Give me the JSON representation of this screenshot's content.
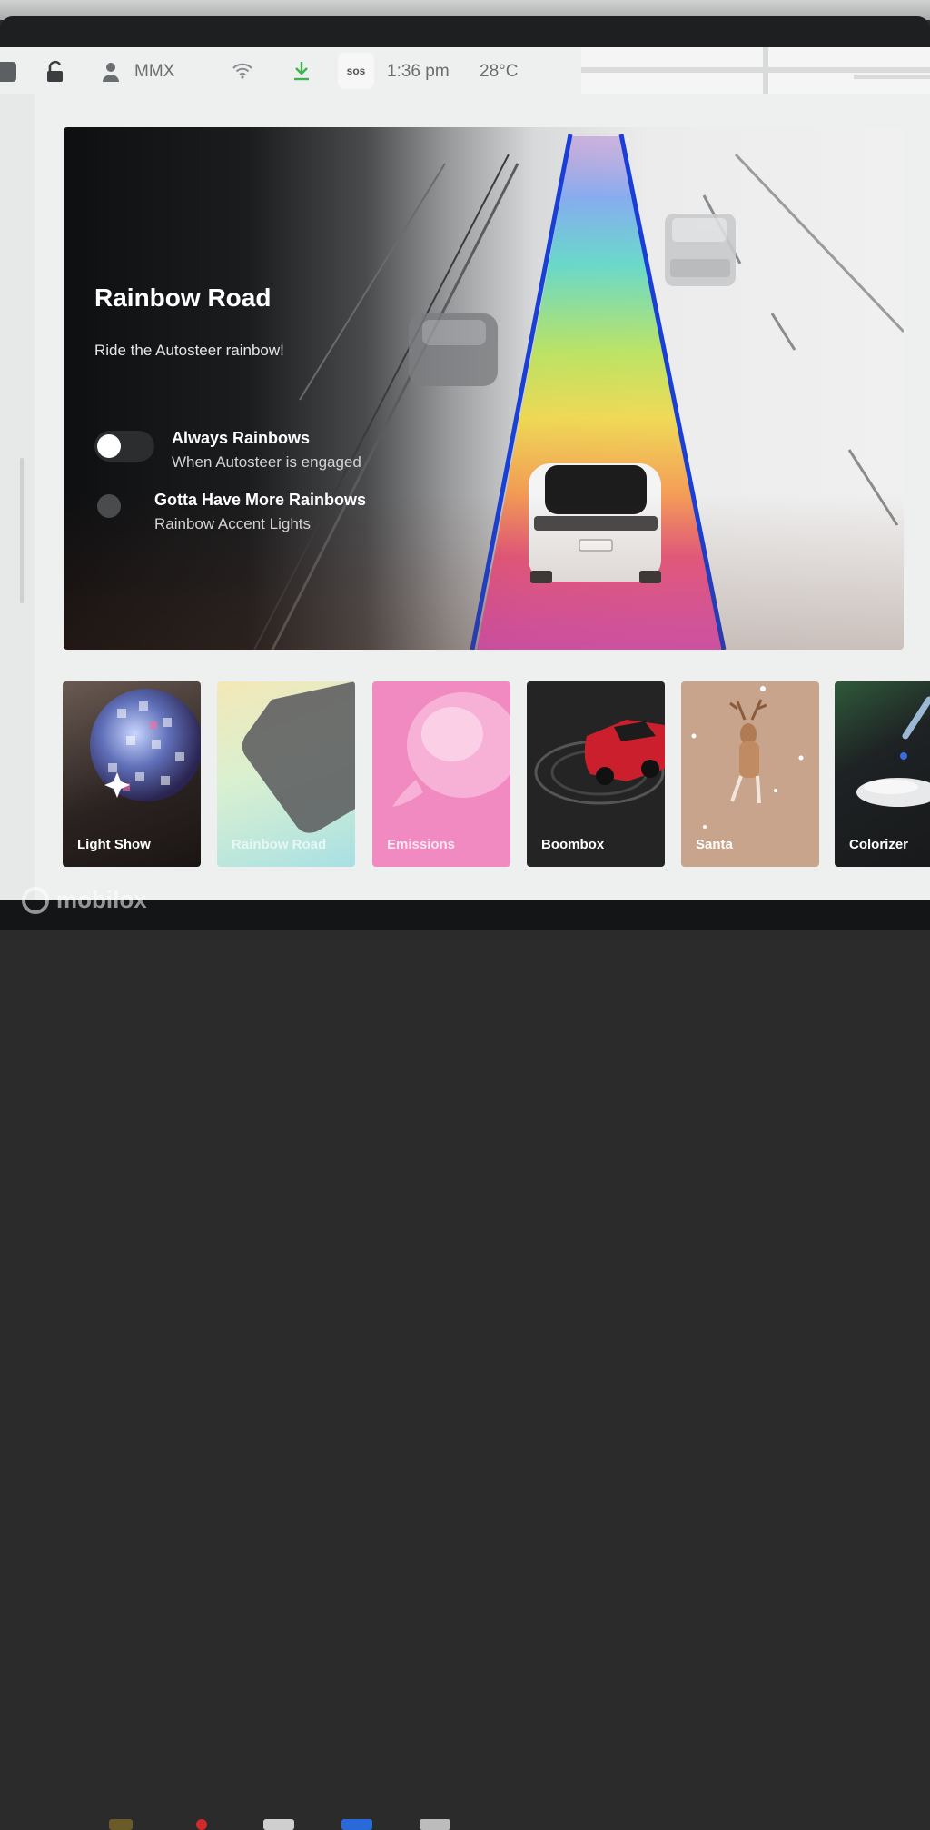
{
  "status_bar": {
    "profile_name": "MMX",
    "sos_label": "sos",
    "time": "1:36 pm",
    "temperature": "28°C"
  },
  "hero": {
    "title": "Rainbow Road",
    "subtitle": "Ride the Autosteer rainbow!",
    "options": [
      {
        "title": "Always Rainbows",
        "subtitle": "When Autosteer is engaged",
        "control": "toggle",
        "enabled": false
      },
      {
        "title": "Gotta Have More Rainbows",
        "subtitle": "Rainbow Accent Lights",
        "control": "radio",
        "enabled": false
      }
    ]
  },
  "tiles": [
    {
      "label": "Light Show",
      "icon": "disco-ball-icon"
    },
    {
      "label": "Rainbow Road",
      "icon": "rainbow-road-icon"
    },
    {
      "label": "Emissions",
      "icon": "whoopee-cushion-icon"
    },
    {
      "label": "Boombox",
      "icon": "car-speaker-icon"
    },
    {
      "label": "Santa",
      "icon": "reindeer-icon"
    },
    {
      "label": "Colorizer",
      "icon": "paint-dropper-icon"
    }
  ],
  "watermark": "mobilox",
  "colors": {
    "lane_blue": "#1a3fd6",
    "emissions_pink": "#f08ac0",
    "santa_tan": "#c9a48c"
  }
}
